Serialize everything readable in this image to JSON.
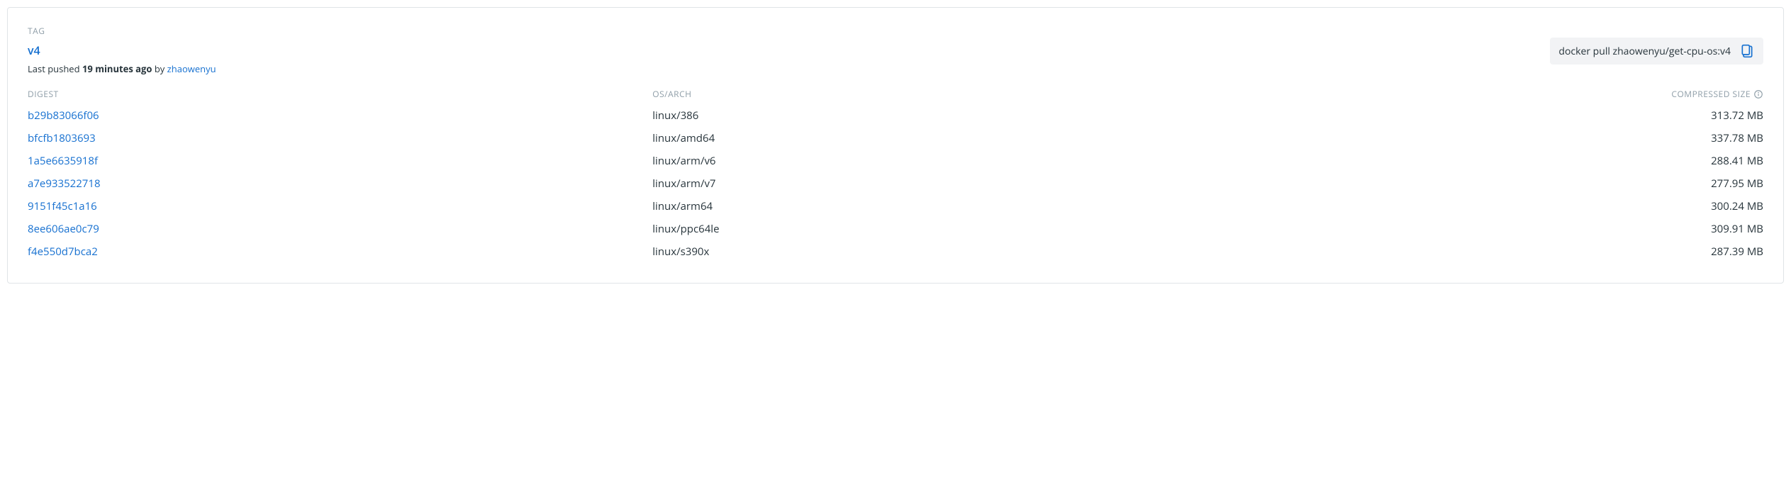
{
  "labels": {
    "tag": "TAG",
    "digest": "DIGEST",
    "osarch": "OS/ARCH",
    "compressed_size": "COMPRESSED SIZE"
  },
  "tag": {
    "name": "v4",
    "pushed_prefix": "Last pushed ",
    "pushed_time": "19 minutes ago",
    "pushed_by_text": " by ",
    "pushed_by_user": "zhaowenyu"
  },
  "pull_command": "docker pull zhaowenyu/get-cpu-os:v4",
  "images": [
    {
      "digest": "b29b83066f06",
      "osarch": "linux/386",
      "size": "313.72 MB"
    },
    {
      "digest": "bfcfb1803693",
      "osarch": "linux/amd64",
      "size": "337.78 MB"
    },
    {
      "digest": "1a5e6635918f",
      "osarch": "linux/arm/v6",
      "size": "288.41 MB"
    },
    {
      "digest": "a7e933522718",
      "osarch": "linux/arm/v7",
      "size": "277.95 MB"
    },
    {
      "digest": "9151f45c1a16",
      "osarch": "linux/arm64",
      "size": "300.24 MB"
    },
    {
      "digest": "8ee606ae0c79",
      "osarch": "linux/ppc64le",
      "size": "309.91 MB"
    },
    {
      "digest": "f4e550d7bca2",
      "osarch": "linux/s390x",
      "size": "287.39 MB"
    }
  ]
}
